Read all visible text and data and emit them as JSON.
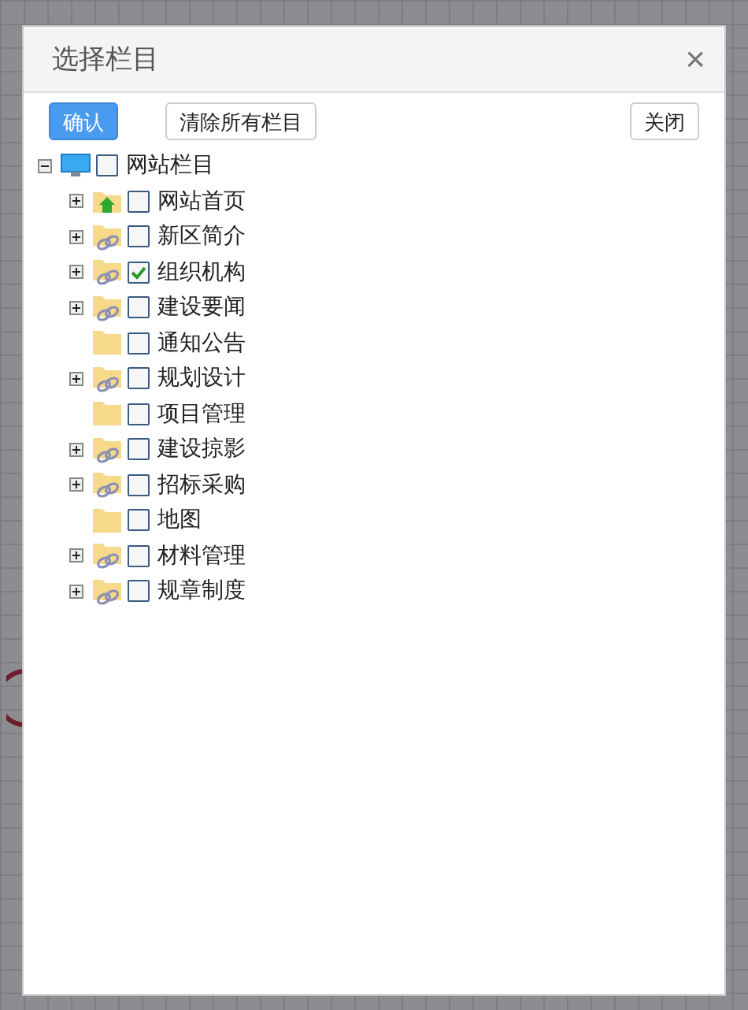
{
  "dialog": {
    "title": "选择栏目",
    "close": "×"
  },
  "buttons": [
    {
      "label": "确认",
      "kind": "primary"
    },
    {
      "label": "清除所有栏目",
      "kind": "default"
    },
    {
      "label": "关闭",
      "kind": "right"
    }
  ],
  "tree": {
    "label": "网站栏目",
    "checked": false,
    "expanded": true,
    "children": [
      {
        "label": "网站首页",
        "kind": "home",
        "expandable": true,
        "checked": false
      },
      {
        "label": "新区简介",
        "kind": "link",
        "expandable": true,
        "checked": false
      },
      {
        "label": "组织机构",
        "kind": "link",
        "expandable": true,
        "checked": true
      },
      {
        "label": "建设要闻",
        "kind": "link",
        "expandable": true,
        "checked": false
      },
      {
        "label": "通知公告",
        "kind": "plain",
        "expandable": false,
        "checked": false
      },
      {
        "label": "规划设计",
        "kind": "link",
        "expandable": true,
        "checked": false
      },
      {
        "label": "项目管理",
        "kind": "plain",
        "expandable": false,
        "checked": false
      },
      {
        "label": "建设掠影",
        "kind": "link",
        "expandable": true,
        "checked": false
      },
      {
        "label": "招标采购",
        "kind": "link",
        "expandable": true,
        "checked": false
      },
      {
        "label": "地图",
        "kind": "plain",
        "expandable": false,
        "checked": false
      },
      {
        "label": "材料管理",
        "kind": "link",
        "expandable": true,
        "checked": false
      },
      {
        "label": "规章制度",
        "kind": "link",
        "expandable": true,
        "checked": false
      }
    ]
  }
}
